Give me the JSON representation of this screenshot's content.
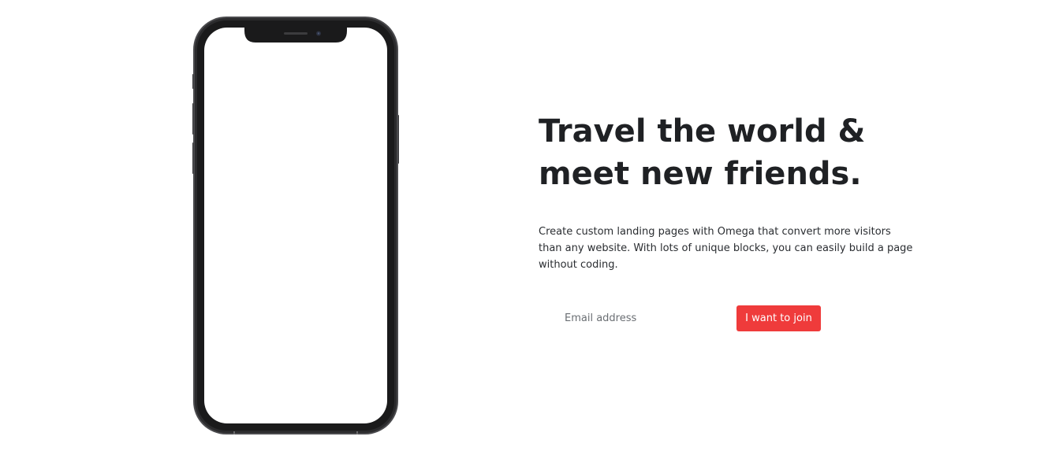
{
  "hero": {
    "title_line1": "Travel the world &",
    "title_line2": "meet new friends.",
    "description": "Create custom landing pages with Omega that convert more visitors than any website. With lots of unique blocks, you can easily build a page without coding."
  },
  "signup": {
    "email_placeholder": "Email address",
    "button_label": "I want to join"
  },
  "colors": {
    "accent": "#ef3b3b",
    "heading": "#1f2124",
    "background": "#ffffff",
    "phone_frame": "#2b2b2d"
  },
  "images": {
    "phone_mockup": "phone-mockup-icon"
  }
}
